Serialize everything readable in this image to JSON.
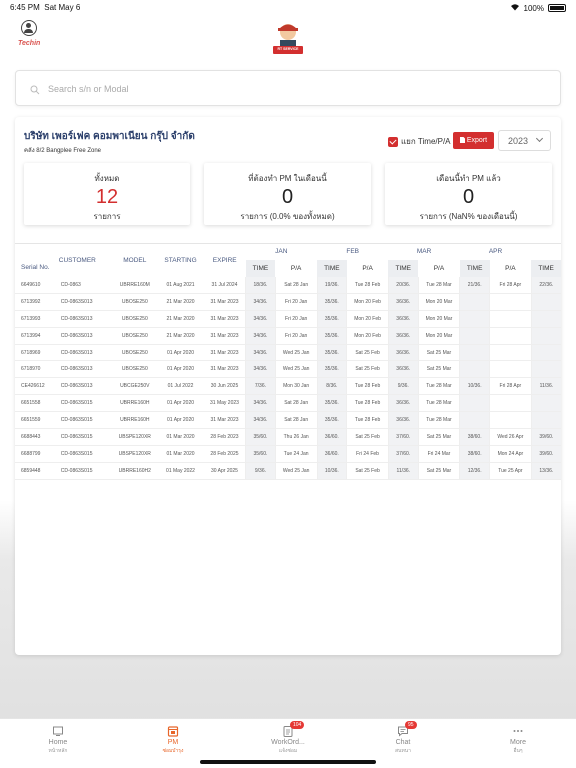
{
  "status": {
    "time": "6:45 PM",
    "date": "Sat May 6",
    "battery": "100%"
  },
  "header": {
    "user_name": "Techin",
    "logo_text": "RT SERVICE"
  },
  "search": {
    "placeholder": "Search s/n or Modal"
  },
  "company": {
    "name": "บริษัท เพอร์เฟค คอมพาเนียน กรุ๊ป จำกัด",
    "address": "คลัง 8/2 Bangplee Free Zone"
  },
  "controls": {
    "split_label": "แยก Time/P/A",
    "export_label": "Export",
    "year": "2023"
  },
  "stats": [
    {
      "label": "ทั้งหมด",
      "value": "12",
      "sub": "รายการ"
    },
    {
      "label": "ที่ต้องทำ PM ในเดือนนี้",
      "value": "0",
      "sub": "รายการ (0.0% ของทั้งหมด)"
    },
    {
      "label": "เดือนนี้ทำ PM แล้ว",
      "value": "0",
      "sub": "รายการ (NaN% ของเดือนนี้)"
    }
  ],
  "table": {
    "columns": [
      "Serial No.",
      "CUSTOMER",
      "MODEL",
      "STARTING",
      "EXPIRE"
    ],
    "months": [
      "JAN",
      "FEB",
      "MAR",
      "APR"
    ],
    "sub_time": "TIME",
    "sub_pa": "P/A",
    "rows": [
      {
        "serial": "6649610",
        "customer": "CD-0863",
        "model": "UBRRE160M",
        "start": "01 Aug 2021",
        "expire": "31 Jul 2024",
        "m": [
          [
            "18/36.",
            "Sat 28 Jan"
          ],
          [
            "19/36.",
            "Tue 28 Feb"
          ],
          [
            "20/36.",
            "Tue 28 Mar"
          ],
          [
            "21/36.",
            "Fri 28 Apr"
          ]
        ],
        "extra": "22/36."
      },
      {
        "serial": "6713992",
        "customer": "CD-0863S013",
        "model": "UBOSE250",
        "start": "21 Mar 2020",
        "expire": "31 Mar 2023",
        "m": [
          [
            "34/36.",
            "Fri 20 Jan"
          ],
          [
            "35/36.",
            "Mon 20 Feb"
          ],
          [
            "36/36.",
            "Mon 20 Mar"
          ],
          [
            "",
            ""
          ]
        ],
        "extra": ""
      },
      {
        "serial": "6713993",
        "customer": "CD-0863S013",
        "model": "UBOSE250",
        "start": "21 Mar 2020",
        "expire": "31 Mar 2023",
        "m": [
          [
            "34/36.",
            "Fri 20 Jan"
          ],
          [
            "35/36.",
            "Mon 20 Feb"
          ],
          [
            "36/36.",
            "Mon 20 Mar"
          ],
          [
            "",
            ""
          ]
        ],
        "extra": ""
      },
      {
        "serial": "6713994",
        "customer": "CD-0863S013",
        "model": "UBOSE250",
        "start": "21 Mar 2020",
        "expire": "31 Mar 2023",
        "m": [
          [
            "34/36.",
            "Fri 20 Jan"
          ],
          [
            "35/36.",
            "Mon 20 Feb"
          ],
          [
            "36/36.",
            "Mon 20 Mar"
          ],
          [
            "",
            ""
          ]
        ],
        "extra": ""
      },
      {
        "serial": "6718969",
        "customer": "CD-0863S013",
        "model": "UBOSE250",
        "start": "01 Apr 2020",
        "expire": "31 Mar 2023",
        "m": [
          [
            "34/36.",
            "Wed 25 Jan"
          ],
          [
            "35/36.",
            "Sat 25 Feb"
          ],
          [
            "36/36.",
            "Sat 25 Mar"
          ],
          [
            "",
            ""
          ]
        ],
        "extra": ""
      },
      {
        "serial": "6718970",
        "customer": "CD-0863S013",
        "model": "UBOSE250",
        "start": "01 Apr 2020",
        "expire": "31 Mar 2023",
        "m": [
          [
            "34/36.",
            "Wed 25 Jan"
          ],
          [
            "35/36.",
            "Sat 25 Feb"
          ],
          [
            "36/36.",
            "Sat 25 Mar"
          ],
          [
            "",
            ""
          ]
        ],
        "extra": ""
      },
      {
        "serial": "CE426612",
        "customer": "CD-0863S013",
        "model": "UBCGE250V",
        "start": "01 Jul 2022",
        "expire": "30 Jun 2025",
        "m": [
          [
            "7/36.",
            "Mon 30 Jan"
          ],
          [
            "8/36.",
            "Tue 28 Feb"
          ],
          [
            "9/36.",
            "Tue 28 Mar"
          ],
          [
            "10/36.",
            "Fri 28 Apr"
          ]
        ],
        "extra": "11/36."
      },
      {
        "serial": "6651558",
        "customer": "CD-0863S015",
        "model": "UBRRE160H",
        "start": "01 Apr 2020",
        "expire": "31 May 2023",
        "m": [
          [
            "34/36.",
            "Sat 28 Jan"
          ],
          [
            "35/36.",
            "Tue 28 Feb"
          ],
          [
            "36/36.",
            "Tue 28 Mar"
          ],
          [
            "",
            ""
          ]
        ],
        "extra": ""
      },
      {
        "serial": "6651559",
        "customer": "CD-0863S015",
        "model": "UBRRE160H",
        "start": "01 Apr 2020",
        "expire": "31 Mar 2023",
        "m": [
          [
            "34/36.",
            "Sat 28 Jan"
          ],
          [
            "35/36.",
            "Tue 28 Feb"
          ],
          [
            "36/36.",
            "Tue 28 Mar"
          ],
          [
            "",
            ""
          ]
        ],
        "extra": ""
      },
      {
        "serial": "6688443",
        "customer": "CD-0863S015",
        "model": "UBSPE120XR",
        "start": "01 Mar 2020",
        "expire": "28 Feb 2023",
        "m": [
          [
            "35/60.",
            "Thu 26 Jan"
          ],
          [
            "36/60.",
            "Sat 25 Feb"
          ],
          [
            "37/60.",
            "Sat 25 Mar"
          ],
          [
            "38/60.",
            "Wed 26 Apr"
          ]
        ],
        "extra": "39/60."
      },
      {
        "serial": "6688799",
        "customer": "CD-0863S015",
        "model": "UBSPE120XR",
        "start": "01 Mar 2020",
        "expire": "28 Feb 2025",
        "m": [
          [
            "35/60.",
            "Tue 24 Jan"
          ],
          [
            "36/60.",
            "Fri 24 Feb"
          ],
          [
            "37/60.",
            "Fri 24 Mar"
          ],
          [
            "38/60.",
            "Mon 24 Apr"
          ]
        ],
        "extra": "39/60."
      },
      {
        "serial": "6859448",
        "customer": "CD-0863S015",
        "model": "UBRRE160H2",
        "start": "01 May 2022",
        "expire": "30 Apr 2025",
        "m": [
          [
            "9/36.",
            "Wed 25 Jan"
          ],
          [
            "10/36.",
            "Sat 25 Feb"
          ],
          [
            "11/36.",
            "Sat 25 Mar"
          ],
          [
            "12/36.",
            "Tue 25 Apr"
          ]
        ],
        "extra": "13/36."
      }
    ]
  },
  "tabs": [
    {
      "label": "Home",
      "sub": "หน้าหลัก",
      "icon": "home-icon",
      "badge": ""
    },
    {
      "label": "PM",
      "sub": "ซ่อมบำรุง",
      "icon": "calendar-icon",
      "badge": ""
    },
    {
      "label": "WorkOrd...",
      "sub": "แจ้งซ่อม",
      "icon": "clipboard-icon",
      "badge": "104"
    },
    {
      "label": "Chat",
      "sub": "สนทนา",
      "icon": "chat-icon",
      "badge": "95"
    },
    {
      "label": "More",
      "sub": "อื่นๆ",
      "icon": "more-icon",
      "badge": ""
    }
  ],
  "colors": {
    "accent": "#d32f2f",
    "active_tab": "#e8662a",
    "heading": "#2b3f6b"
  }
}
